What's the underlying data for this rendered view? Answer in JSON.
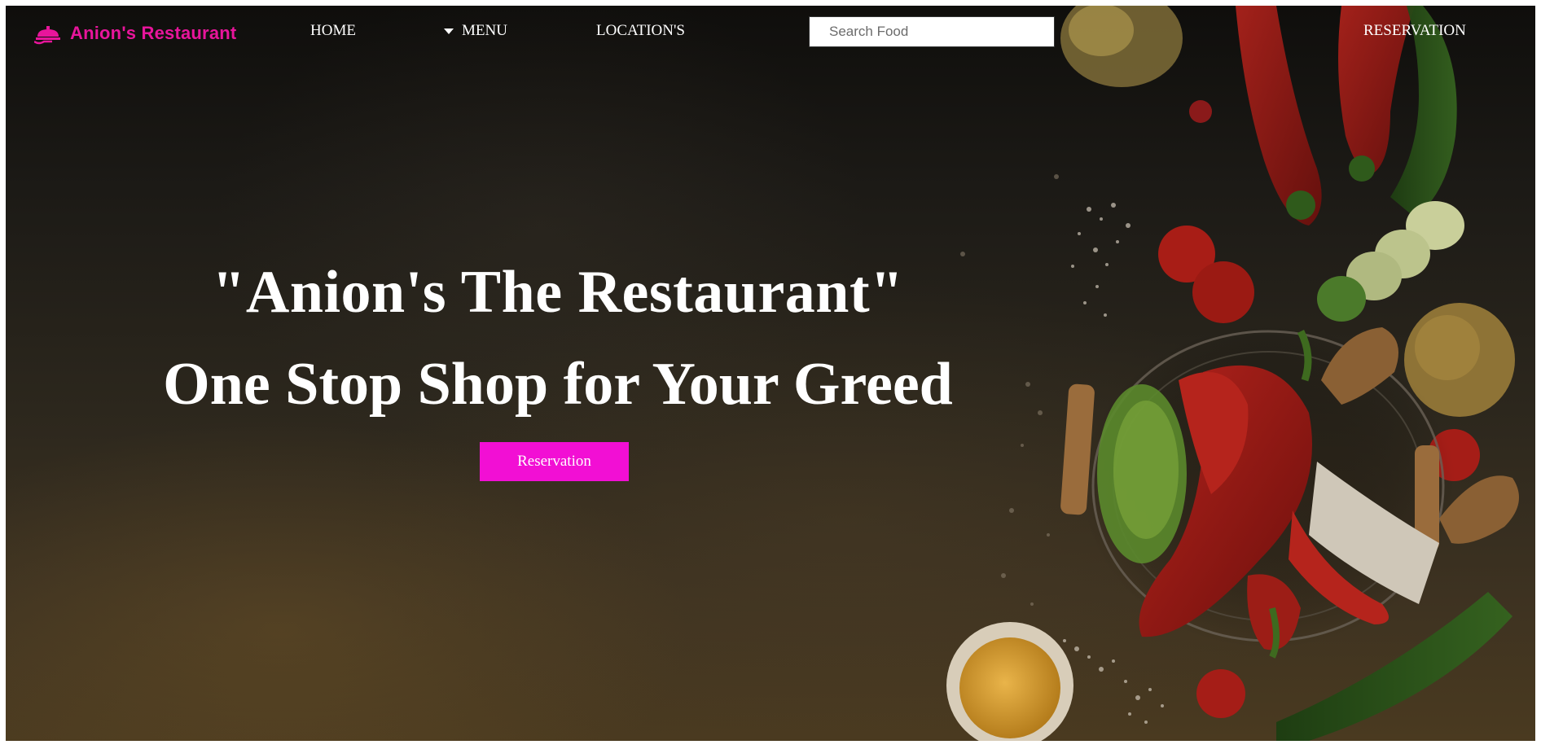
{
  "brand": {
    "name": "Anion's Restaurant",
    "color": "#e8159b"
  },
  "nav": {
    "home": "HOME",
    "menu": "MENU",
    "locations": "LOCATION'S",
    "reservation": "RESERVATION"
  },
  "search": {
    "placeholder": "Search Food",
    "value": ""
  },
  "hero": {
    "title": "\"Anion's The Restaurant\"",
    "subtitle": "One Stop Shop for Your Greed",
    "button_label": "Reservation",
    "button_color": "#f20fd4"
  },
  "icons": {
    "brand": "food-tray-icon",
    "menu_caret": "caret-down-icon"
  }
}
